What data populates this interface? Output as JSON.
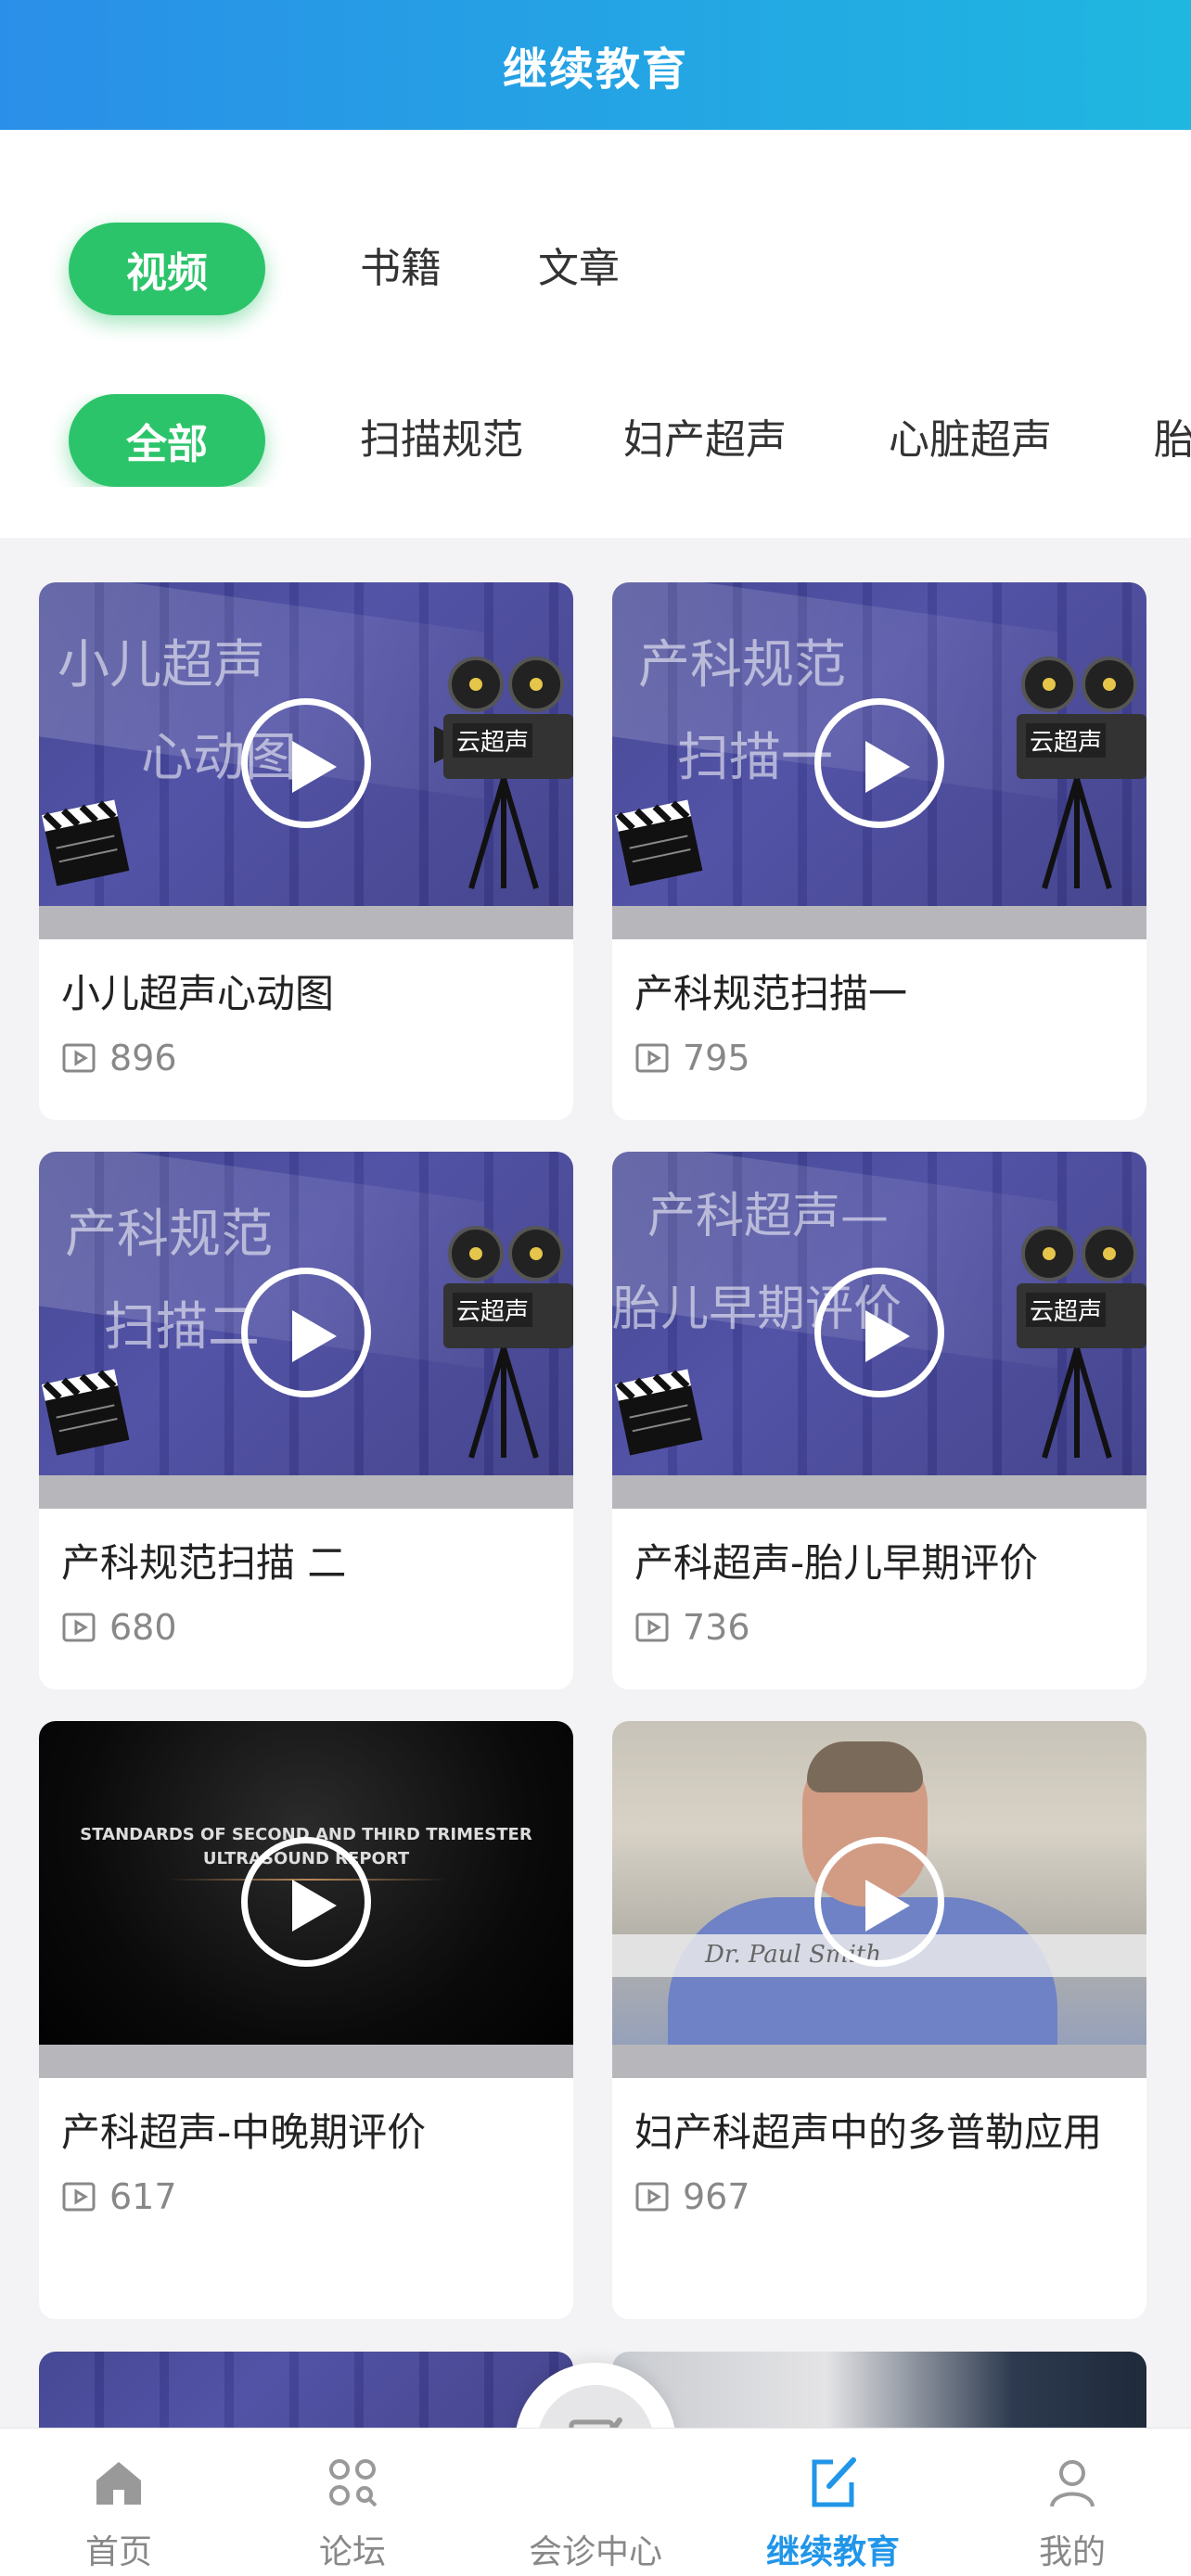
{
  "header": {
    "title": "继续教育"
  },
  "tabs": [
    {
      "label": "视频",
      "active": true
    },
    {
      "label": "书籍",
      "active": false
    },
    {
      "label": "文章",
      "active": false
    }
  ],
  "categories": [
    {
      "label": "全部",
      "active": true
    },
    {
      "label": "扫描规范",
      "active": false
    },
    {
      "label": "妇产超声",
      "active": false
    },
    {
      "label": "心脏超声",
      "active": false
    }
  ],
  "videos": [
    {
      "title": "小儿超声心动图",
      "views": "896",
      "thumb_lines": [
        "小儿超声",
        "心动图"
      ],
      "thumb_badge": "云超声"
    },
    {
      "title": "产科规范扫描一",
      "views": "795",
      "thumb_lines": [
        "产科规范",
        "扫描一"
      ],
      "thumb_badge": "云超声"
    },
    {
      "title": "产科规范扫描 二",
      "views": "680",
      "thumb_lines": [
        "产科规范",
        "扫描二"
      ],
      "thumb_badge": "云超声"
    },
    {
      "title": "产科超声-胎儿早期评价",
      "views": "736",
      "thumb_lines": [
        "产科超声—",
        "胎儿早期评价"
      ],
      "thumb_badge": "云超声"
    },
    {
      "title": "产科超声-中晚期评价",
      "views": "617",
      "thumb_lines": [
        "STANDARDS OF SECOND AND THIRD TRIMESTER",
        "ULTRASOUND REPORT"
      ]
    },
    {
      "title": "妇产科超声中的多普勒应用",
      "views": "967",
      "thumb_caption": "Dr. Paul Smith"
    }
  ],
  "tabbar": [
    {
      "label": "首页",
      "icon": "home-icon",
      "active": false
    },
    {
      "label": "论坛",
      "icon": "forum-icon",
      "active": false
    },
    {
      "label": "会诊中心",
      "icon": "consult-icon",
      "active": false
    },
    {
      "label": "继续教育",
      "icon": "edit-icon",
      "active": true
    },
    {
      "label": "我的",
      "icon": "profile-icon",
      "active": false
    }
  ],
  "colors": {
    "header_start": "#2a8fe8",
    "header_end": "#1fb7e0",
    "pill": "#2cc46a",
    "tab_active": "#2196e8"
  }
}
